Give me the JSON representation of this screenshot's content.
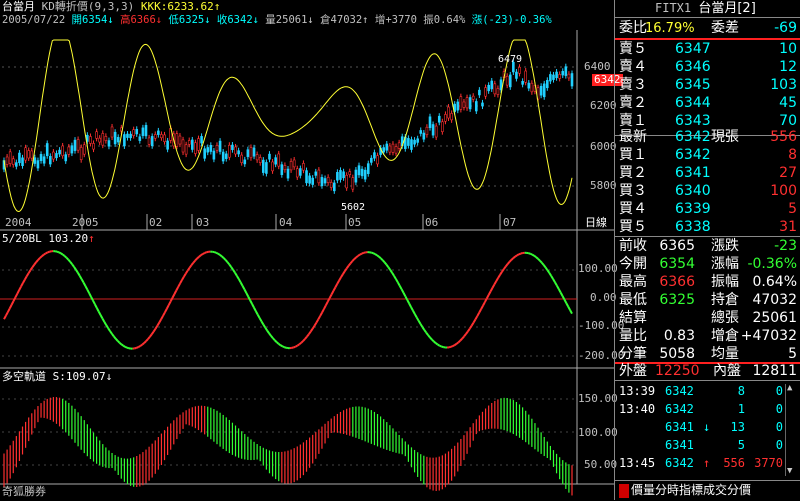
{
  "header": {
    "line1": {
      "name": "台當月",
      "indicator": "KD轉折價(9,3,3)",
      "kkk": "KKK:6233.62↑"
    },
    "line2": {
      "date": "2005/07/22",
      "open": "開6354↓",
      "high": "高6366↓",
      "low": "低6325↓",
      "close": "收6342↓",
      "vol": "量25061↓",
      "oi": "倉47032↑",
      "inc": "增+3770",
      "amp": "振0.64%",
      "chg": "漲(-23)-0.36%"
    }
  },
  "main_chart": {
    "price_labels": [
      "6400",
      "6200",
      "6000",
      "5800"
    ],
    "current_price": "6342",
    "high_annot": "6479",
    "low_annot": "5602",
    "x_labels": [
      "2004",
      "2005",
      "02",
      "03",
      "04",
      "05",
      "06",
      "07"
    ],
    "period": "日線"
  },
  "sub1": {
    "title": "5/20BL",
    "value": "103.20",
    "arrow": "↑",
    "ticks": [
      "100.00",
      "0.00",
      "-100.00",
      "-200.00"
    ]
  },
  "sub2": {
    "title": "多空軌道",
    "value": "S:109.07↓",
    "ticks": [
      "150.00",
      "100.00",
      "50.00"
    ]
  },
  "footer": {
    "broker": "奇狐勝券"
  },
  "panel": {
    "product": "FITX1",
    "product_name": "台當月[2]",
    "ratio_label": "委比",
    "ratio_value": "16.79%",
    "diff_label": "委差",
    "diff_value": "-69",
    "asks": [
      {
        "label": "賣５",
        "price": "6347",
        "qty": "10"
      },
      {
        "label": "賣４",
        "price": "6346",
        "qty": "12"
      },
      {
        "label": "賣３",
        "price": "6345",
        "qty": "103"
      },
      {
        "label": "賣２",
        "price": "6344",
        "qty": "45"
      },
      {
        "label": "賣１",
        "price": "6343",
        "qty": "70"
      }
    ],
    "last_label": "最新",
    "last_price": "6342",
    "cur_label": "現張",
    "cur_value": "556",
    "bids": [
      {
        "label": "買１",
        "price": "6342",
        "qty": "8"
      },
      {
        "label": "買２",
        "price": "6341",
        "qty": "27"
      },
      {
        "label": "買３",
        "price": "6340",
        "qty": "100"
      },
      {
        "label": "買４",
        "price": "6339",
        "qty": "5"
      },
      {
        "label": "買５",
        "price": "6338",
        "qty": "31"
      }
    ],
    "stats": [
      {
        "l1": "前收",
        "v1": "6365",
        "l2": "漲跌",
        "v2": "-23",
        "c1": "w",
        "c2": "g"
      },
      {
        "l1": "今開",
        "v1": "6354",
        "l2": "漲幅",
        "v2": "-0.36%",
        "c1": "g",
        "c2": "g"
      },
      {
        "l1": "最高",
        "v1": "6366",
        "l2": "振幅",
        "v2": "0.64%",
        "c1": "r",
        "c2": "w"
      },
      {
        "l1": "最低",
        "v1": "6325",
        "l2": "持倉",
        "v2": "47032",
        "c1": "g",
        "c2": "w"
      },
      {
        "l1": "結算",
        "v1": "",
        "l2": "總張",
        "v2": "25061",
        "c1": "w",
        "c2": "w"
      },
      {
        "l1": "量比",
        "v1": "0.83",
        "l2": "增倉",
        "v2": "+47032",
        "c1": "w",
        "c2": "w"
      },
      {
        "l1": "分筆",
        "v1": "5058",
        "l2": "均量",
        "v2": "5",
        "c1": "w",
        "c2": "w"
      }
    ],
    "outer_label": "外盤",
    "outer_value": "12250",
    "inner_label": "內盤",
    "inner_value": "12811",
    "ticks": [
      {
        "time": "13:39",
        "price": "6342",
        "arrow": "",
        "qty": "8",
        "extra": "0"
      },
      {
        "time": "13:40",
        "price": "6342",
        "arrow": "",
        "qty": "1",
        "extra": "0"
      },
      {
        "time": "",
        "price": "6341",
        "arrow": "↓",
        "qty": "13",
        "extra": "0"
      },
      {
        "time": "",
        "price": "6341",
        "arrow": "",
        "qty": "5",
        "extra": "0"
      },
      {
        "time": "13:45",
        "price": "6342",
        "arrow": "↑",
        "qty": "556",
        "extra": "3770"
      }
    ],
    "bottom_tabs": "價量分時指標成交分價"
  },
  "colors": {
    "up": "#ff3030",
    "down": "#33ff33",
    "kd_line": "#ffff33",
    "bg": "#000000"
  }
}
